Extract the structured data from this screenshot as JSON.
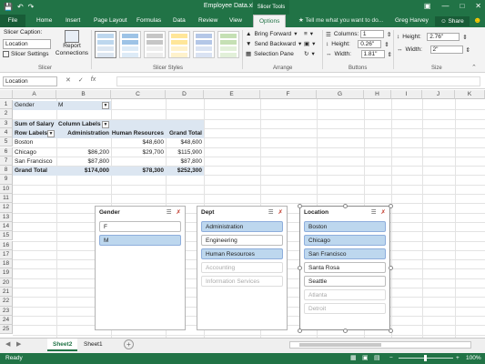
{
  "window": {
    "title": "Employee Data.xlsx - Excel",
    "context_tab_group": "Slicer Tools",
    "qat": [
      "save",
      "undo",
      "redo"
    ]
  },
  "tabs": {
    "file": "File",
    "items": [
      "Home",
      "Insert",
      "Page Layout",
      "Formulas",
      "Data",
      "Review",
      "View",
      "Options"
    ],
    "active": "Options",
    "tell_me": "Tell me what you want to do...",
    "user": "Greg Harvey",
    "share": "Share"
  },
  "ribbon": {
    "slicer_group": {
      "caption_label": "Slicer Caption:",
      "caption_value": "Location",
      "settings_label": "Slicer Settings",
      "report_connections": "Report Connections",
      "group_label": "Slicer"
    },
    "styles_group": {
      "group_label": "Slicer Styles"
    },
    "arrange_group": {
      "bring_forward": "Bring Forward",
      "send_backward": "Send Backward",
      "selection_pane": "Selection Pane",
      "group_label": "Arrange"
    },
    "buttons_group": {
      "columns_label": "Columns:",
      "columns_value": "1",
      "height_label": "Height:",
      "height_value": "0.26\"",
      "width_label": "Width:",
      "width_value": "1.81\"",
      "group_label": "Buttons"
    },
    "size_group": {
      "height_label": "Height:",
      "height_value": "2.76\"",
      "width_label": "Width:",
      "width_value": "2\"",
      "group_label": "Size"
    }
  },
  "formula_bar": {
    "name_box": "Location",
    "fx": "fx"
  },
  "grid": {
    "columns": [
      "A",
      "B",
      "C",
      "D",
      "E",
      "F",
      "G",
      "H",
      "I",
      "J",
      "K"
    ],
    "rows": [
      "1",
      "2",
      "3",
      "4",
      "5",
      "6",
      "7",
      "8",
      "9",
      "10",
      "11",
      "12",
      "13",
      "14",
      "15",
      "16",
      "17",
      "18",
      "19",
      "20",
      "21",
      "22",
      "23",
      "24",
      "25"
    ],
    "cells": {
      "a1": "Gender",
      "b1": "M",
      "a3": "Sum of Salary",
      "b3": "Column Labels",
      "a4": "Row Labels",
      "b4": "Administration",
      "c4": "Human Resources",
      "d4": "Grand Total",
      "a5": "Boston",
      "c5": "$48,600",
      "d5": "$48,600",
      "a6": "Chicago",
      "b6": "$86,200",
      "c6": "$29,700",
      "d6": "$115,900",
      "a7": "San Francisco",
      "b7": "$87,800",
      "d7": "$87,800",
      "a8": "Grand Total",
      "b8": "$174,000",
      "c8": "$78,300",
      "d8": "$252,300"
    }
  },
  "slicers": {
    "gender": {
      "title": "Gender",
      "items": [
        {
          "label": "F",
          "state": "unselected"
        },
        {
          "label": "M",
          "state": "selected"
        }
      ]
    },
    "dept": {
      "title": "Dept",
      "items": [
        {
          "label": "Administration",
          "state": "selected"
        },
        {
          "label": "Engineering",
          "state": "unselected"
        },
        {
          "label": "Human Resources",
          "state": "selected"
        },
        {
          "label": "Accounting",
          "state": "nodata"
        },
        {
          "label": "Information Services",
          "state": "nodata"
        }
      ]
    },
    "location": {
      "title": "Location",
      "items": [
        {
          "label": "Boston",
          "state": "selected"
        },
        {
          "label": "Chicago",
          "state": "selected"
        },
        {
          "label": "San Francisco",
          "state": "selected"
        },
        {
          "label": "Santa Rosa",
          "state": "unselected"
        },
        {
          "label": "Seattle",
          "state": "unselected"
        },
        {
          "label": "Atlanta",
          "state": "nodata"
        },
        {
          "label": "Detroit",
          "state": "nodata"
        }
      ]
    }
  },
  "sheets": {
    "tabs": [
      "Sheet2",
      "Sheet1"
    ],
    "active": "Sheet2",
    "add": "+"
  },
  "status": {
    "ready": "Ready",
    "zoom": "100%"
  },
  "colors": {
    "excel_green": "#217346",
    "selected_item": "#bdd7ee",
    "pivot_band": "#dce6f1"
  }
}
